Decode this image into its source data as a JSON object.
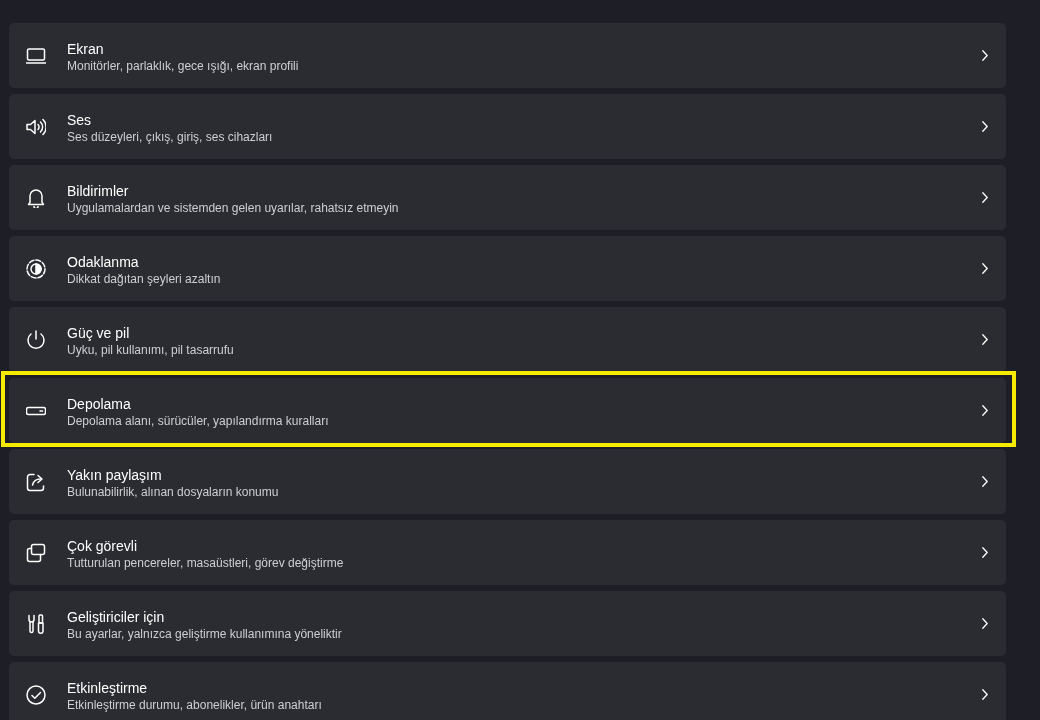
{
  "items": [
    {
      "title": "Ekran",
      "subtitle": "Monitörler, parlaklık, gece ışığı, ekran profili",
      "highlighted": false
    },
    {
      "title": "Ses",
      "subtitle": "Ses düzeyleri, çıkış, giriş, ses cihazları",
      "highlighted": false
    },
    {
      "title": "Bildirimler",
      "subtitle": "Uygulamalardan ve sistemden gelen uyarılar, rahatsız etmeyin",
      "highlighted": false
    },
    {
      "title": "Odaklanma",
      "subtitle": "Dikkat dağıtan şeyleri azaltın",
      "highlighted": false
    },
    {
      "title": "Güç ve pil",
      "subtitle": "Uyku, pil kullanımı, pil tasarrufu",
      "highlighted": false
    },
    {
      "title": "Depolama",
      "subtitle": "Depolama alanı, sürücüler, yapılandırma kuralları",
      "highlighted": true
    },
    {
      "title": "Yakın paylaşım",
      "subtitle": "Bulunabilirlik, alınan dosyaların konumu",
      "highlighted": false
    },
    {
      "title": "Çok görevli",
      "subtitle": "Tutturulan pencereler, masaüstleri, görev değiştirme",
      "highlighted": false
    },
    {
      "title": "Geliştiriciler için",
      "subtitle": "Bu ayarlar, yalnızca geliştirme kullanımına yöneliktir",
      "highlighted": false
    },
    {
      "title": "Etkinleştirme",
      "subtitle": "Etkinleştirme durumu, abonelikler, ürün anahtarı",
      "highlighted": false
    }
  ]
}
